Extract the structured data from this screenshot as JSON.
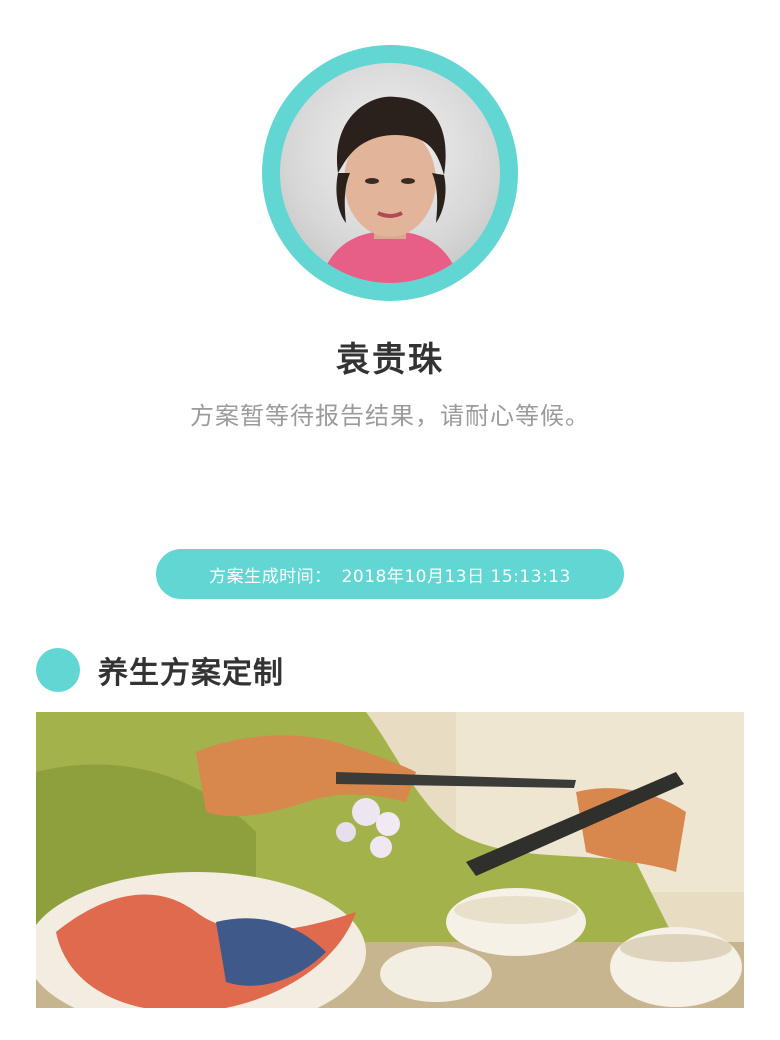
{
  "profile": {
    "name": "袁贵珠",
    "subtitle": "方案暂等待报告结果，请耐心等候。"
  },
  "plan_time": {
    "label": "方案生成时间：",
    "value": "2018年10月13日 15:13:13"
  },
  "section": {
    "title": "养生方案定制"
  },
  "colors": {
    "accent": "#62d6d2",
    "text_dark": "#333333",
    "text_muted": "#9b9b9b"
  }
}
